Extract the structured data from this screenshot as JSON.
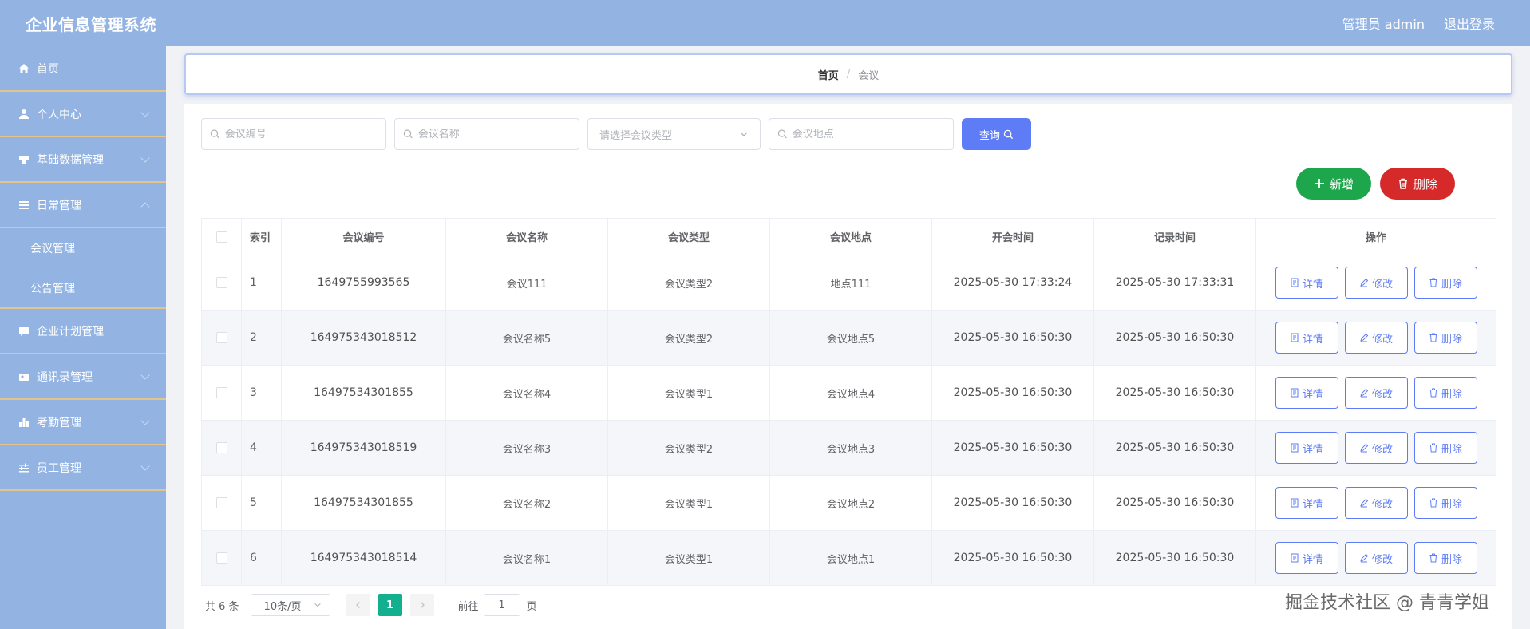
{
  "header": {
    "title": "企业信息管理系统",
    "user": "管理员 admin",
    "logout": "退出登录"
  },
  "sidebar": {
    "items": [
      {
        "label": "首页",
        "icon": "home-icon"
      },
      {
        "label": "个人中心",
        "icon": "user-icon"
      },
      {
        "label": "基础数据管理",
        "icon": "data-icon"
      },
      {
        "label": "日常管理",
        "icon": "list-icon"
      },
      {
        "label": "会议管理"
      },
      {
        "label": "公告管理"
      },
      {
        "label": "企业计划管理",
        "icon": "chat-icon"
      },
      {
        "label": "通讯录管理",
        "icon": "contacts-icon"
      },
      {
        "label": "考勤管理",
        "icon": "chart-icon"
      },
      {
        "label": "员工管理",
        "icon": "sliders-icon"
      }
    ]
  },
  "breadcrumb": {
    "home": "首页",
    "sep": "/",
    "current": "会议"
  },
  "search": {
    "code_placeholder": "会议编号",
    "name_placeholder": "会议名称",
    "type_placeholder": "请选择会议类型",
    "place_placeholder": "会议地点",
    "query_label": "查询"
  },
  "actions": {
    "add_label": "新增",
    "delete_label": "删除"
  },
  "table": {
    "headers": {
      "index": "索引",
      "code": "会议编号",
      "name": "会议名称",
      "type": "会议类型",
      "place": "会议地点",
      "start": "开会时间",
      "record": "记录时间",
      "ops": "操作"
    },
    "op_labels": {
      "detail": "详情",
      "edit": "修改",
      "delete": "删除"
    },
    "rows": [
      {
        "index": "1",
        "code": "1649755993565",
        "name": "会议111",
        "type": "会议类型2",
        "place": "地点111",
        "start": "2025-05-30 17:33:24",
        "record": "2025-05-30 17:33:31"
      },
      {
        "index": "2",
        "code": "164975343018512",
        "name": "会议名称5",
        "type": "会议类型2",
        "place": "会议地点5",
        "start": "2025-05-30 16:50:30",
        "record": "2025-05-30 16:50:30"
      },
      {
        "index": "3",
        "code": "16497534301855",
        "name": "会议名称4",
        "type": "会议类型1",
        "place": "会议地点4",
        "start": "2025-05-30 16:50:30",
        "record": "2025-05-30 16:50:30"
      },
      {
        "index": "4",
        "code": "164975343018519",
        "name": "会议名称3",
        "type": "会议类型2",
        "place": "会议地点3",
        "start": "2025-05-30 16:50:30",
        "record": "2025-05-30 16:50:30"
      },
      {
        "index": "5",
        "code": "16497534301855",
        "name": "会议名称2",
        "type": "会议类型1",
        "place": "会议地点2",
        "start": "2025-05-30 16:50:30",
        "record": "2025-05-30 16:50:30"
      },
      {
        "index": "6",
        "code": "164975343018514",
        "name": "会议名称1",
        "type": "会议类型1",
        "place": "会议地点1",
        "start": "2025-05-30 16:50:30",
        "record": "2025-05-30 16:50:30"
      }
    ]
  },
  "pagination": {
    "total": "共 6 条",
    "page_size": "10条/页",
    "current": "1",
    "goto": "前往",
    "goto_value": "1",
    "page_unit": "页"
  },
  "watermark": {
    "bottom": "掘金技术社区 @ 青青学姐"
  },
  "colors": {
    "header_bg": "#93b4e3",
    "primary": "#5e7cf6",
    "add": "#1ea64d",
    "danger": "#d62a2a",
    "page_active": "#13b08f"
  }
}
